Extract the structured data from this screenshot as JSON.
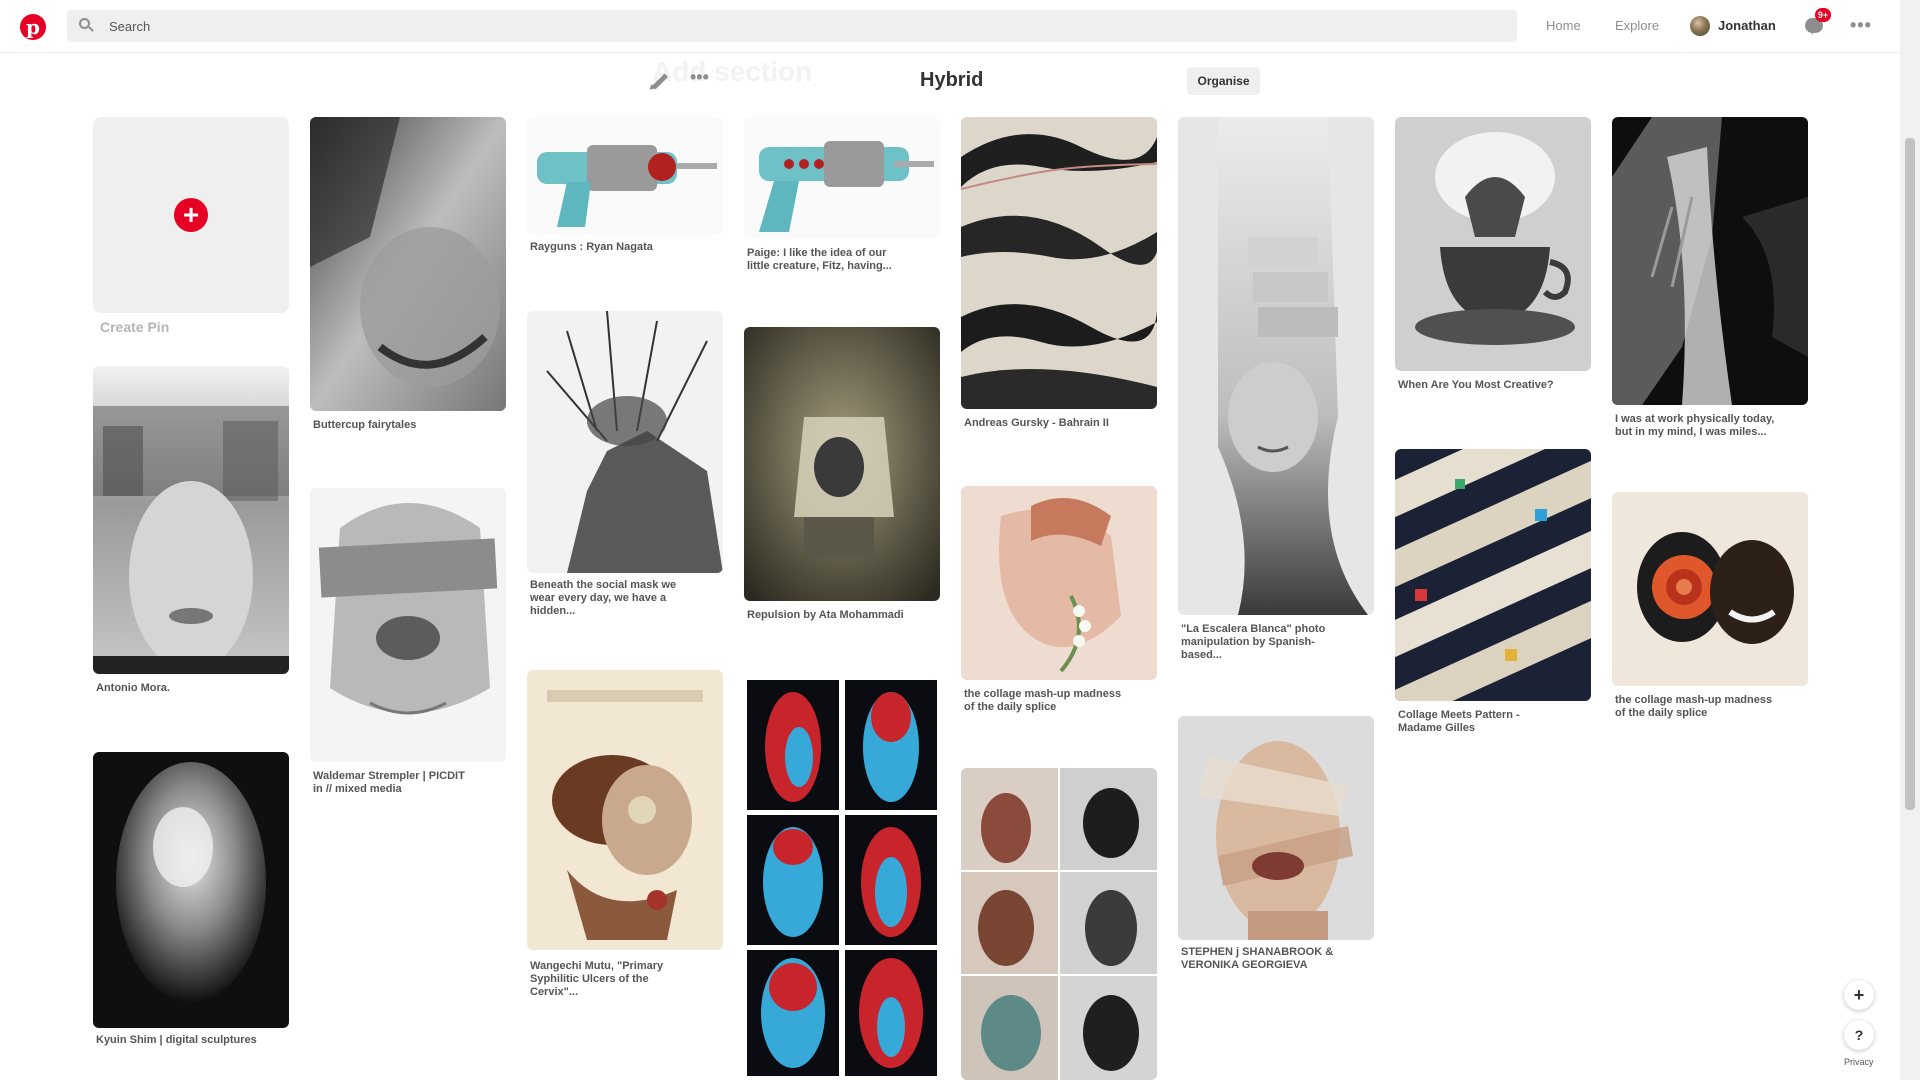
{
  "header": {
    "logo_letter": "p",
    "search_placeholder": "Search",
    "nav_home": "Home",
    "nav_explore": "Explore",
    "user_name": "Jonathan",
    "messages_badge": "9+",
    "more": "•••"
  },
  "board": {
    "ghost_text": "Add section",
    "more": "•••",
    "title": "Hybrid",
    "organise_label": "Organise"
  },
  "create_pin": {
    "plus": "+",
    "label": "Create Pin"
  },
  "pins": [
    {
      "caption_1": "Antonio Mora.",
      "caption_2": ""
    },
    {
      "caption_1": "Kyuin Shim | digital sculptures",
      "caption_2": ""
    },
    {
      "caption_1": "Buttercup fairytales",
      "caption_2": ""
    },
    {
      "caption_1": "Waldemar Strempler | PICDIT",
      "caption_2": "in // mixed media"
    },
    {
      "caption_1": "Rayguns : Ryan Nagata",
      "caption_2": ""
    },
    {
      "caption_1": "Beneath the social mask we",
      "caption_2": "wear every day, we have a",
      "caption_3": "hidden..."
    },
    {
      "caption_1": "Wangechi Mutu, \"Primary",
      "caption_2": "Syphilitic Ulcers of the",
      "caption_3": "Cervix\"..."
    },
    {
      "caption_1": "Paige: I like the idea of our",
      "caption_2": "little creature, Fitz, having..."
    },
    {
      "caption_1": "Repulsion by Ata Mohammadi",
      "caption_2": ""
    },
    {
      "caption_1": "Andreas Gursky - Bahrain II",
      "caption_2": ""
    },
    {
      "caption_1": "the collage mash-up madness",
      "caption_2": "of the daily splice"
    },
    {
      "caption_1": "\"La Escalera Blanca\" photo",
      "caption_2": "manipulation by Spanish-",
      "caption_3": "based..."
    },
    {
      "caption_1": "STEPHEN j SHANABROOK &",
      "caption_2": "VERONIKA GEORGIEVA"
    },
    {
      "caption_1": "When Are You Most Creative?",
      "caption_2": ""
    },
    {
      "caption_1": "Collage Meets Pattern -",
      "caption_2": "Madame Gilles"
    },
    {
      "caption_1": "I was at work physically today,",
      "caption_2": "but in my mind, I was miles..."
    },
    {
      "caption_1": "the collage mash-up madness",
      "caption_2": "of the daily splice"
    }
  ],
  "floating": {
    "plus": "+",
    "help": "?",
    "privacy": "Privacy"
  },
  "colors": {
    "brand": "#e60023",
    "text": "#333333",
    "muted": "#8e8e8e"
  }
}
